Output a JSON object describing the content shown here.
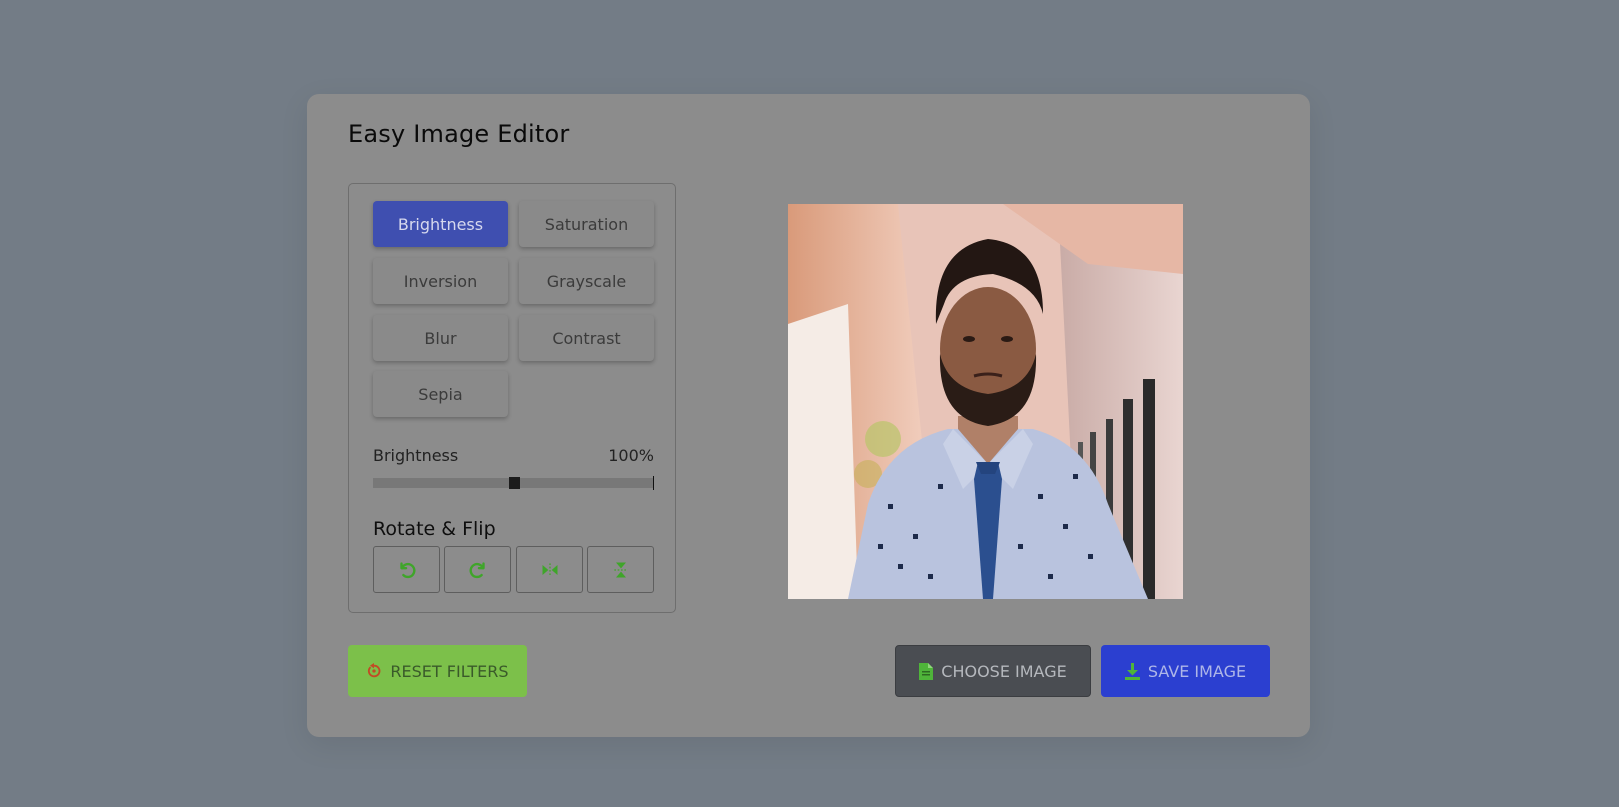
{
  "app": {
    "title": "Easy Image Editor"
  },
  "filters": {
    "buttons": [
      {
        "label": "Brightness",
        "active": true
      },
      {
        "label": "Saturation",
        "active": false
      },
      {
        "label": "Inversion",
        "active": false
      },
      {
        "label": "Grayscale",
        "active": false
      },
      {
        "label": "Blur",
        "active": false
      },
      {
        "label": "Contrast",
        "active": false
      },
      {
        "label": "Sepia",
        "active": false
      }
    ]
  },
  "slider": {
    "name": "Brightness",
    "value_text": "100%",
    "value": 100,
    "min": 0,
    "max": 200
  },
  "rotate_flip": {
    "title": "Rotate & Flip",
    "buttons": [
      "rotate-left-icon",
      "rotate-right-icon",
      "flip-horizontal-icon",
      "flip-vertical-icon"
    ]
  },
  "actions": {
    "reset_label": "RESET FILTERS",
    "choose_label": "CHOOSE IMAGE",
    "save_label": "SAVE IMAGE"
  },
  "colors": {
    "overlay_bg": "#737c86",
    "active_filter": "#3f4fb0",
    "reset_button": "#7cc04a",
    "choose_button": "#4a4d52",
    "save_button": "#2b3fd0",
    "icon_green": "#3fa52a"
  }
}
